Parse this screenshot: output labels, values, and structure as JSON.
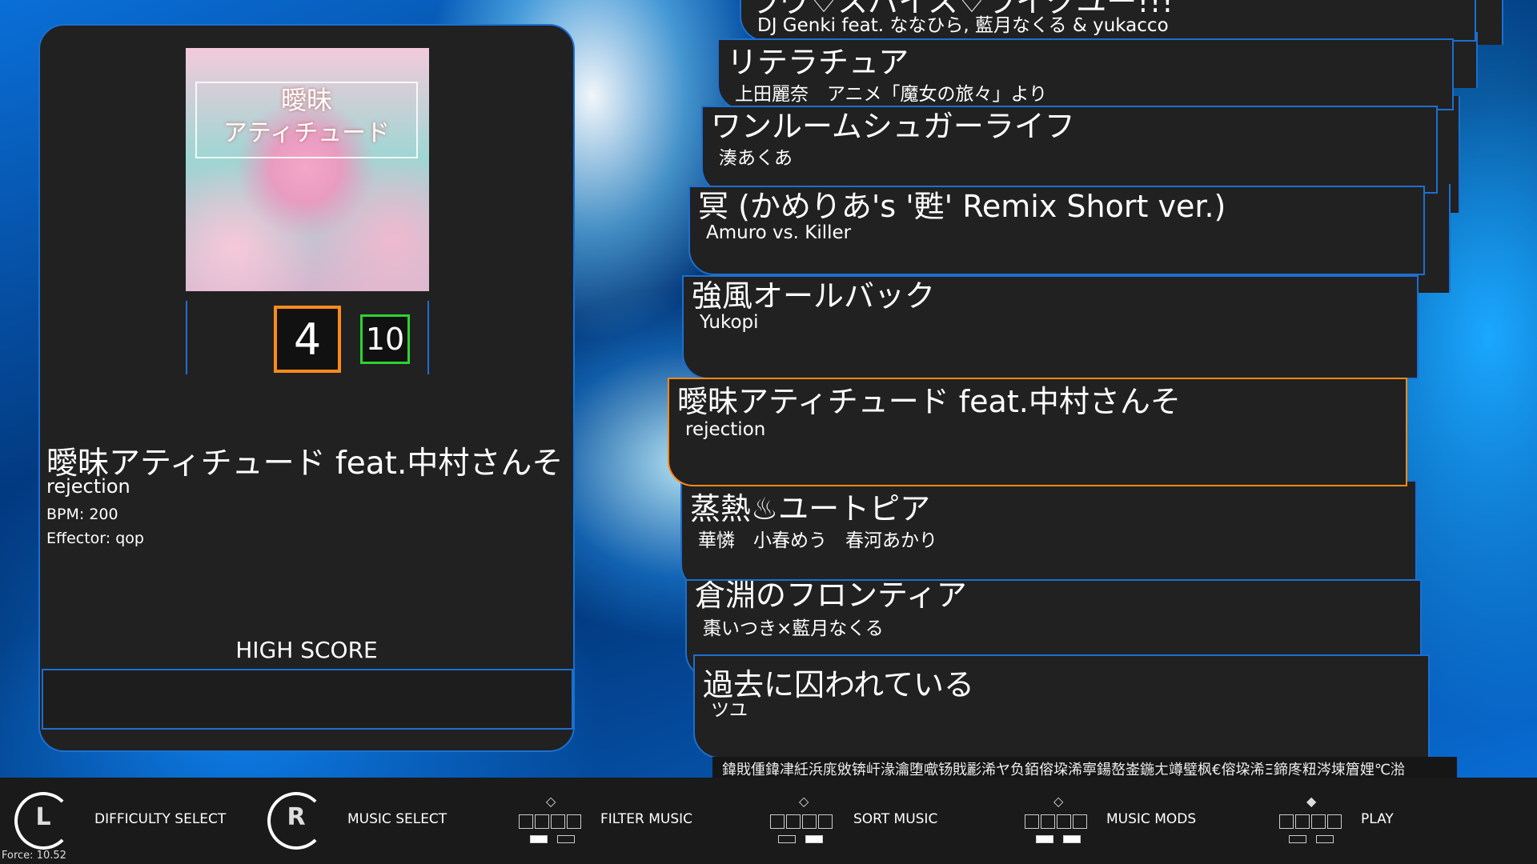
{
  "details": {
    "jacket_text": [
      "曖昧",
      "アティチュード"
    ],
    "difficulty_main": "4",
    "difficulty_next": "10",
    "title": "曖昧アティチュード feat.中村さんそ",
    "artist": "rejection",
    "bpm": "BPM: 200",
    "effector": "Effector: qop",
    "high_score_label": "HIGH SCORE"
  },
  "songs": [
    {
      "title": "ラヴ♡スパイス♡ライクユー!!!",
      "artist": "DJ Genki feat. ななひら, 藍月なくる & yukacco"
    },
    {
      "title": "リテラチュア",
      "artist": "上田麗奈　アニメ「魔女の旅々」より"
    },
    {
      "title": "ワンルームシュガーライフ",
      "artist": "湊あくあ"
    },
    {
      "title": "冥 (かめりあ's '甦' Remix Short ver.)",
      "artist": "Amuro vs. Killer"
    },
    {
      "title": "強風オールバック",
      "artist": "Yukopi"
    },
    {
      "title": "曖昧アティチュード feat.中村さんそ",
      "artist": "rejection"
    },
    {
      "title": "蒸熱♨ユートピア",
      "artist": "華憐　小春めう　春河あかり"
    },
    {
      "title": "倉淵のフロンティア",
      "artist": "棗いつき×藍月なくる"
    },
    {
      "title": "過去に囚われている",
      "artist": "ツユ"
    }
  ],
  "strip_text": "鍏戝偅鍏冿紝浜庣敓锛屽湪瀹堕噷钖戝彲浠ヤ负銆傛垜浠寕鍚嶅崟鍦ㄤ竴璧枫€傛垜浠Ξ鍗庝粈涔堜篃娌℃湁",
  "bottom_bar": {
    "knob_l": "L",
    "knob_r": "R",
    "difficulty_select": "DIFFICULTY SELECT",
    "music_select": "MUSIC SELECT",
    "filter_music": "FILTER MUSIC",
    "sort_music": "SORT MUSIC",
    "music_mods": "MUSIC MODS",
    "play": "PLAY",
    "force": "Force: 10.52"
  },
  "colors": {
    "accent_blue": "#1c6fd0",
    "selected_orange": "#ff8a1a",
    "next_green": "#2cd432"
  }
}
